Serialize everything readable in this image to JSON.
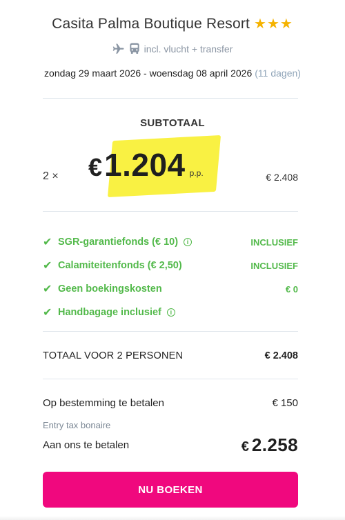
{
  "hotel": {
    "name": "Casita Palma Boutique Resort",
    "stars": "★★★",
    "star_count": 3
  },
  "transport": {
    "text": "incl. vlucht + transfer",
    "icons": [
      "airplane-icon",
      "bus-icon"
    ]
  },
  "dates": {
    "range": "zondag 29 maart 2026 - woensdag 08 april 2026",
    "duration": "(11 dagen)"
  },
  "subtotal": {
    "label": "SUBTOTAAL",
    "quantity": "2 ×",
    "currency": "€",
    "price_pp": "1.204",
    "pp_label": "p.p.",
    "total": "€ 2.408"
  },
  "inclusions": [
    {
      "label": "SGR-garantiefonds  (€ 10)",
      "info": true,
      "value": "INCLUSIEF"
    },
    {
      "label": "Calamiteitenfonds  (€ 2,50)",
      "info": false,
      "value": "INCLUSIEF"
    },
    {
      "label": "Geen boekingskosten",
      "info": false,
      "value": "€ 0"
    },
    {
      "label": "Handbagage inclusief",
      "info": true,
      "value": ""
    }
  ],
  "total": {
    "label": "TOTAAL VOOR 2 PERSONEN",
    "value": "€ 2.408"
  },
  "destination": {
    "label": "Op bestemming te betalen",
    "value": "€ 150",
    "note": "Entry tax bonaire"
  },
  "pay_us": {
    "label": "Aan ons te betalen",
    "currency": "€",
    "amount": "2.258"
  },
  "book_button": {
    "label": "NU BOEKEN"
  },
  "colors": {
    "accent": "#f0087e",
    "success": "#52b94a",
    "star": "#f5b301",
    "highlight": "#f9f039",
    "muted": "#8fa4b8"
  }
}
